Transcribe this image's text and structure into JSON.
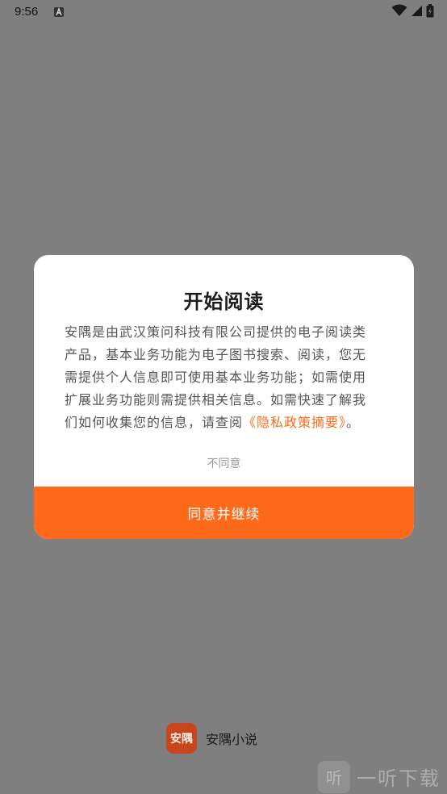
{
  "status_bar": {
    "time": "9:56",
    "notification_icon": "font-a-icon",
    "wifi_icon": "wifi-icon",
    "signal_icon": "cell-signal-icon",
    "battery_icon": "battery-icon"
  },
  "dialog": {
    "title": "开始阅读",
    "body_text": "安隅是由武汉策问科技有限公司提供的电子阅读类产品，基本业务功能为电子图书搜索、阅读，您无需提供个人信息即可使用基本业务功能；如需使用扩展业务功能则需提供相关信息。如需快速了解我们如何收集您的信息，请查阅",
    "policy_link": "《隐私政策摘要》",
    "body_end": "。",
    "disagree_label": "不同意",
    "agree_label": "同意并继续"
  },
  "brand": {
    "logo_text": "安隅",
    "app_name": "安隅小说"
  },
  "watermark": {
    "badge_text": "听",
    "text": "一听下载"
  },
  "colors": {
    "accent": "#ff6a1a",
    "overlay": "#7f7f7f"
  }
}
